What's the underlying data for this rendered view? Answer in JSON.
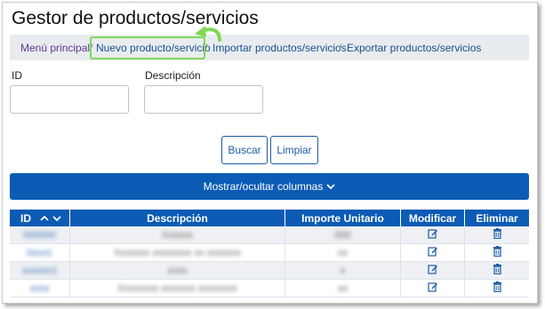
{
  "page": {
    "title": "Gestor de productos/servicios"
  },
  "breadcrumb": {
    "items": [
      "Menú principal",
      "Nuevo producto/servicio",
      "Importar productos/servicios",
      "Exportar productos/servicios"
    ],
    "separator": "/"
  },
  "search": {
    "id_label": "ID",
    "id_value": "",
    "description_label": "Descripción",
    "description_value": ""
  },
  "buttons": {
    "search": "Buscar",
    "clear": "Limpiar"
  },
  "columns_toggle": {
    "label": "Mostrar/ocultar columnas",
    "icon": "chevron-down-icon"
  },
  "table": {
    "headers": [
      "ID",
      "Descripción",
      "Importe Unitario",
      "Modificar",
      "Eliminar"
    ],
    "sort_icons": [
      "chevron-up-icon",
      "chevron-down-icon"
    ],
    "rows": [
      {
        "id": "000000",
        "description": "Xxxxxx",
        "price": "000"
      },
      {
        "id": "0xxx1",
        "description": "Xxxxxxx xxxxxxxx xx xxxxxxx",
        "price": "xx"
      },
      {
        "id": "xxxxxx1",
        "description": "xxxx",
        "price": "x"
      },
      {
        "id": "xxxx",
        "description": "Xxxxxxxx xxxxxxx xxxxxxxx",
        "price": "xx"
      }
    ],
    "row_actions": {
      "edit_icon": "edit-icon",
      "delete_icon": "trash-icon"
    }
  },
  "colors": {
    "primary": "#0c5bb5",
    "highlight": "#7ed957",
    "visited_link": "#5b3a8c",
    "link": "#1b4f8f"
  }
}
